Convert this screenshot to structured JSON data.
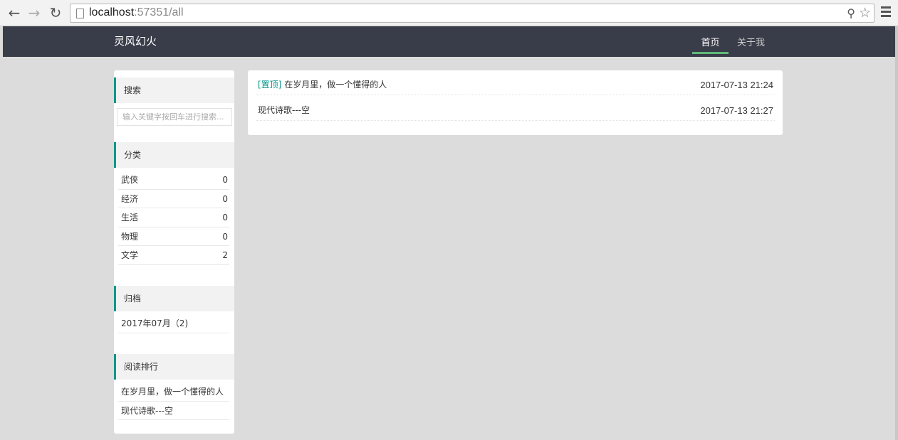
{
  "browser": {
    "url_host": "localhost",
    "url_port_path": ":57351/all"
  },
  "header": {
    "brand": "灵风幻火",
    "nav": [
      {
        "label": "首页",
        "active": true
      },
      {
        "label": "关于我",
        "active": false
      }
    ],
    "accent": "#5fb878",
    "background": "#393d49"
  },
  "sidebar": {
    "accent": "#009688",
    "search": {
      "title": "搜索",
      "placeholder": "输入关键字按回车进行搜索..."
    },
    "categories": {
      "title": "分类",
      "items": [
        {
          "name": "武侠",
          "count": "0"
        },
        {
          "name": "经济",
          "count": "0"
        },
        {
          "name": "生活",
          "count": "0"
        },
        {
          "name": "物理",
          "count": "0"
        },
        {
          "name": "文学",
          "count": "2"
        }
      ]
    },
    "archive": {
      "title": "归档",
      "items": [
        {
          "label": "2017年07月（2)"
        }
      ]
    },
    "ranking": {
      "title": "阅读排行",
      "items": [
        {
          "label": "在岁月里，做一个懂得的人"
        },
        {
          "label": "现代诗歌---空"
        }
      ]
    }
  },
  "posts": [
    {
      "tag": "[置顶]",
      "title": "在岁月里，做一个懂得的人",
      "date": "2017-07-13 21:24"
    },
    {
      "tag": "",
      "title": "现代诗歌---空",
      "date": "2017-07-13 21:27"
    }
  ]
}
